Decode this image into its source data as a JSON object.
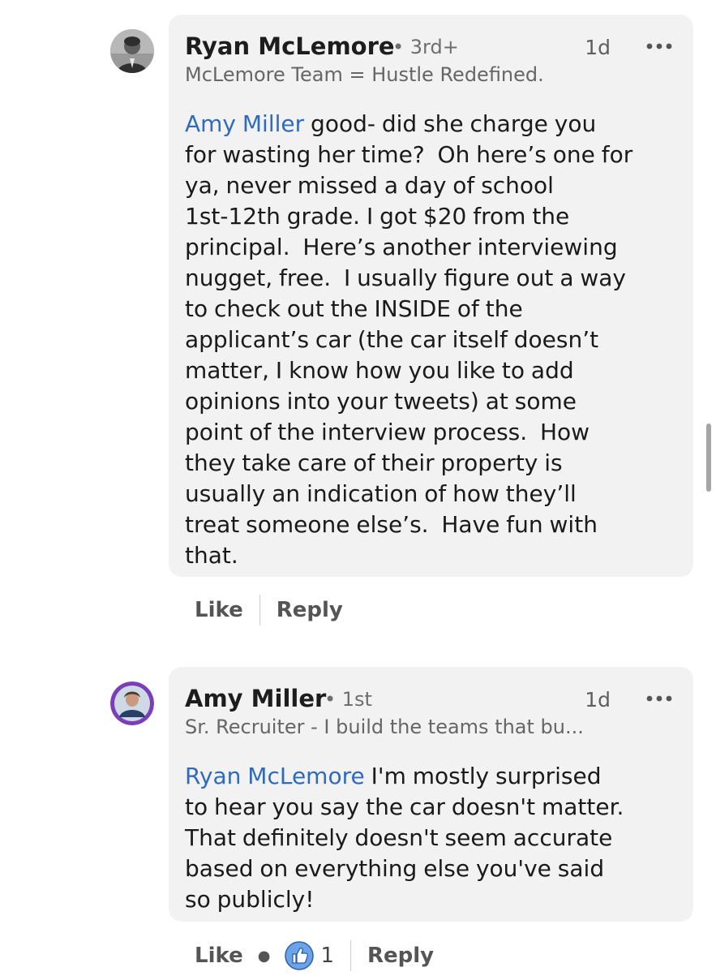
{
  "comments": [
    {
      "author": "Ryan McLemore",
      "degree": "• 3rd+",
      "time": "1d",
      "headline": "McLemore Team = Hustle Redefined.",
      "mention": "Amy Miller",
      "text": " good- did she charge you\nfor wasting her time?  Oh here’s one for\nya, never missed a day of school\n1st-12th grade. I got $20 from the\nprincipal.  Here’s another interviewing\nnugget, free.  I usually figure out a way\nto check out the INSIDE of the\napplicant’s car (the car itself doesn’t\nmatter, I know how you like to add\nopinions into your tweets) at some\npoint of the interview process.  How\nthey take care of their property is\nusually an indication of how they’ll\ntreat someone else’s.  Have fun with\nthat.",
      "like_label": "Like",
      "reply_label": "Reply"
    },
    {
      "author": "Amy Miller",
      "degree": "• 1st",
      "time": "1d",
      "headline": "Sr. Recruiter - I build the teams that bu...",
      "mention": "Ryan McLemore",
      "text": " I'm mostly surprised\nto hear you say the car doesn't matter.\nThat definitely doesn't seem accurate\nbased on everything else you've said\nso publicly!",
      "like_label": "Like",
      "reaction_count": "1",
      "reply_label": "Reply"
    }
  ],
  "icons": {
    "more": "more-horizontal-icon",
    "reaction": "thumbs-up-icon",
    "accent_color": "#2f6bbd",
    "bubble_color": "#f2f2f2"
  }
}
